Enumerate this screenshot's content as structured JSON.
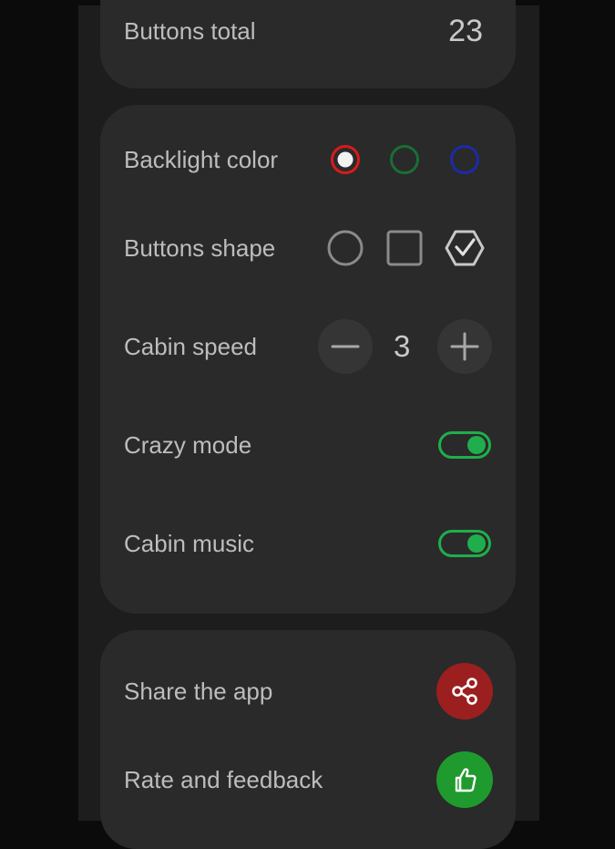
{
  "stats": {
    "buttons_total_label": "Buttons total",
    "buttons_total_value": "23"
  },
  "settings": {
    "backlight_label": "Backlight color",
    "backlight_options": [
      {
        "name": "red",
        "color": "#d81b1b",
        "selected": true
      },
      {
        "name": "green",
        "color": "#1a6e35",
        "selected": false
      },
      {
        "name": "blue",
        "color": "#1c2aa8",
        "selected": false
      }
    ],
    "shape_label": "Buttons shape",
    "shape_options": [
      "circle",
      "square",
      "hexagon"
    ],
    "shape_selected": "hexagon",
    "speed_label": "Cabin speed",
    "speed_value": "3",
    "crazy_label": "Crazy mode",
    "crazy_on": true,
    "music_label": "Cabin music",
    "music_on": true
  },
  "actions": {
    "share_label": "Share the app",
    "share_color": "#9c1f1f",
    "rate_label": "Rate and feedback",
    "rate_color": "#1f9a2e"
  },
  "icons": [
    "share-icon",
    "thumbs-up-icon",
    "minus-icon",
    "plus-icon",
    "check-icon"
  ]
}
